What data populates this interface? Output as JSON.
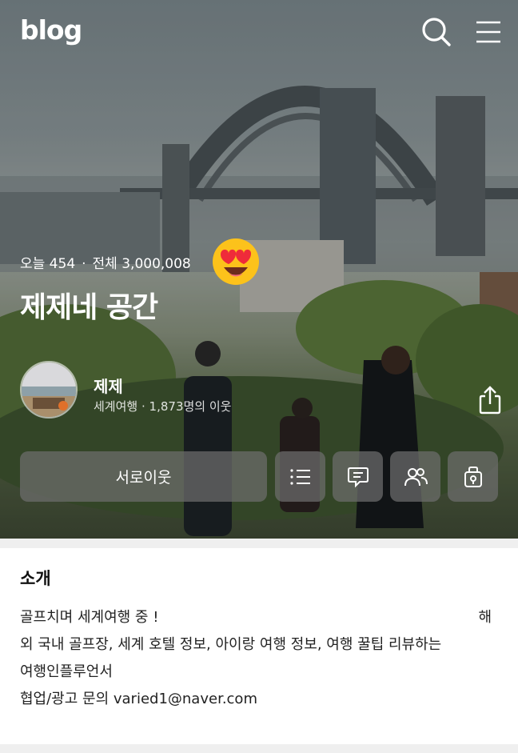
{
  "header": {
    "logo": "blog",
    "search_icon": "search-icon",
    "menu_icon": "menu-icon"
  },
  "profile": {
    "today_label": "오늘 454",
    "total_label": "전체 3,000,008",
    "blog_title": "제제네 공간",
    "name": "제제",
    "category": "세계여행",
    "neighbors": "1,873명의 이웃",
    "separator": "·"
  },
  "actions": {
    "main_button": "서로이웃",
    "icons": [
      "list-icon",
      "message-icon",
      "neighbors-icon",
      "clip-icon"
    ]
  },
  "intro": {
    "heading": "소개",
    "line1_left": "골프치며 세계여행 중 !",
    "line1_right": "해",
    "line2": "외 국내 골프장, 세계 호텔 정보, 아이랑 여행 정보, 여행 꿀팁 리뷰하는",
    "line3": "여행인플루언서",
    "line4": "협업/광고 문의 varied1@naver.com"
  },
  "colors": {
    "button_bg": "#6e6e6e",
    "text_white": "#ffffff"
  }
}
